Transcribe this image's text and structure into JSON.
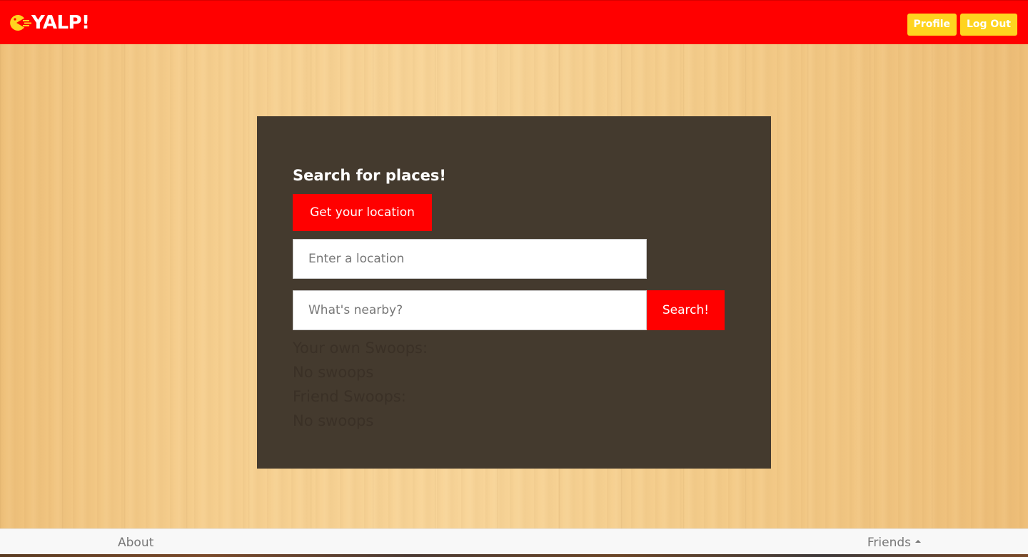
{
  "header": {
    "brand_text": "YALP!",
    "brand_icon": "pacman-logo-icon",
    "profile_label": "Profile",
    "logout_label": "Log Out"
  },
  "search_panel": {
    "title": "Search for places!",
    "location_button_label": "Get your location",
    "location_input": {
      "value": "",
      "placeholder": "Enter a location"
    },
    "nearby_input": {
      "value": "",
      "placeholder": "What's nearby?"
    },
    "search_button_label": "Search!",
    "own_swoops_heading": "Your own Swoops:",
    "own_swoops_empty": "No swoops",
    "friend_swoops_heading": "Friend Swoops:",
    "friend_swoops_empty": "No swoops"
  },
  "footer": {
    "about_label": "About",
    "friends_label": "Friends",
    "friends_icon": "caret-up-icon"
  },
  "colors": {
    "brand_red": "#ff0000",
    "nav_button_yellow": "#ffd41f",
    "panel_brown": "#443a2e",
    "swoops_text": "#3a3026",
    "footer_bg": "#f8f8f8"
  }
}
